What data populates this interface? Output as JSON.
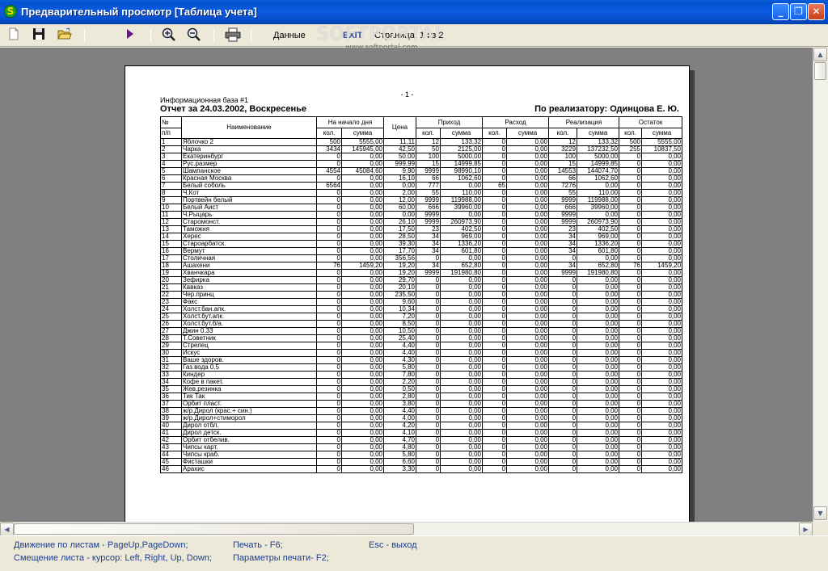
{
  "window": {
    "title": "Предварительный просмотр [Таблица учета]",
    "app_icon": "S",
    "controls": {
      "minimize": "_",
      "maximize": "❐",
      "close": "✕"
    }
  },
  "toolbar": {
    "data_label": "Данные",
    "exit_label": "EXIT",
    "page_label": "Страница: 1 из 2",
    "icons": [
      "new-document-icon",
      "save-icon",
      "open-folder-icon",
      "play-icon",
      "zoom-in-icon",
      "zoom-out-icon",
      "print-icon"
    ]
  },
  "watermark": {
    "text": "SOFTPORTAL",
    "url_text": "www.softportal.com"
  },
  "report": {
    "page_number": "- 1 -",
    "infobase": "Информационная база #1",
    "title": "Отчет за 24.03.2002, Воскресенье",
    "seller": "По реализатору: Одинцова Е. Ю.",
    "headers": {
      "num_top": "№",
      "num_bottom": "п/п",
      "name": "Наименование",
      "start": "На начало дня",
      "price": "Цена",
      "income": "Приход",
      "expense": "Расход",
      "sales": "Реализация",
      "rest": "Остаток",
      "qty": "кол.",
      "sum": "сумма"
    },
    "rows": [
      [
        "1",
        "Яблочко 2",
        "500",
        "5555,00",
        "11,11",
        "12",
        "133,32",
        "0",
        "0,00",
        "12",
        "133,32",
        "500",
        "5555,00"
      ],
      [
        "2",
        "Чарка",
        "3434",
        "145945,00",
        "42,50",
        "50",
        "2125,00",
        "0",
        "0,00",
        "3229",
        "137232,50",
        "255",
        "10837,50"
      ],
      [
        "3",
        "Екатеринбург",
        "0",
        "0,00",
        "50,00",
        "100",
        "5000,00",
        "0",
        "0,00",
        "100",
        "5000,00",
        "0",
        "0,00"
      ],
      [
        "4",
        "Рус.размер",
        "0",
        "0,00",
        "999,99",
        "15",
        "14999,85",
        "0",
        "0,00",
        "15",
        "14999,85",
        "0",
        "0,00"
      ],
      [
        "5",
        "Шампанское",
        "4554",
        "45084,60",
        "9,90",
        "9999",
        "98990,10",
        "0",
        "0,00",
        "14553",
        "144074,70",
        "0",
        "0,00"
      ],
      [
        "6",
        "Красная Москва",
        "0",
        "0,00",
        "16,10",
        "66",
        "1062,60",
        "0",
        "0,00",
        "66",
        "1062,60",
        "0",
        "0,00"
      ],
      [
        "7",
        "Белый соболь",
        "6564",
        "0,00",
        "0,00",
        "777",
        "0,00",
        "65",
        "0,00",
        "7276",
        "0,00",
        "0",
        "0,00"
      ],
      [
        "8",
        "Ч.Кот",
        "0",
        "0,00",
        "2,00",
        "55",
        "110,00",
        "0",
        "0,00",
        "55",
        "110,00",
        "0",
        "0,00"
      ],
      [
        "9",
        "Портвейн белый",
        "0",
        "0,00",
        "12,00",
        "9999",
        "119988,00",
        "0",
        "0,00",
        "9999",
        "119988,00",
        "0",
        "0,00"
      ],
      [
        "10",
        "Белый Аист",
        "0",
        "0,00",
        "60,00",
        "666",
        "39960,00",
        "0",
        "0,00",
        "666",
        "39960,00",
        "0",
        "0,00"
      ],
      [
        "11",
        "Ч.Рыцарь",
        "0",
        "0,00",
        "0,00",
        "9999",
        "0,00",
        "0",
        "0,00",
        "9999",
        "0,00",
        "0",
        "0,00"
      ],
      [
        "12",
        "Старомонст.",
        "0",
        "0,00",
        "26,10",
        "9999",
        "260973,90",
        "0",
        "0,00",
        "9999",
        "260973,90",
        "0",
        "0,00"
      ],
      [
        "13",
        "Таможня",
        "0",
        "0,00",
        "17,50",
        "23",
        "402,50",
        "0",
        "0,00",
        "23",
        "402,50",
        "0",
        "0,00"
      ],
      [
        "14",
        "Херес",
        "0",
        "0,00",
        "28,50",
        "34",
        "969,00",
        "0",
        "0,00",
        "34",
        "969,00",
        "0",
        "0,00"
      ],
      [
        "15",
        "Староарбатск.",
        "0",
        "0,00",
        "39,30",
        "34",
        "1336,20",
        "0",
        "0,00",
        "34",
        "1336,20",
        "0",
        "0,00"
      ],
      [
        "16",
        "Вермут",
        "0",
        "0,00",
        "17,70",
        "34",
        "601,80",
        "0",
        "0,00",
        "34",
        "601,80",
        "0",
        "0,00"
      ],
      [
        "17",
        "Столичная",
        "0",
        "0,00",
        "356,56",
        "0",
        "0,00",
        "0",
        "0,00",
        "0",
        "0,00",
        "0",
        "0,00"
      ],
      [
        "18",
        "Ашахени",
        "76",
        "1459,20",
        "19,20",
        "34",
        "652,80",
        "0",
        "0,00",
        "34",
        "652,80",
        "76",
        "1459,20"
      ],
      [
        "19",
        "Хванчкара",
        "0",
        "0,00",
        "19,20",
        "9999",
        "191980,80",
        "0",
        "0,00",
        "9999",
        "191980,80",
        "0",
        "0,00"
      ],
      [
        "20",
        "Зефирка",
        "0",
        "0,00",
        "29,70",
        "0",
        "0,00",
        "0",
        "0,00",
        "0",
        "0,00",
        "0",
        "0,00"
      ],
      [
        "21",
        "Кавказ",
        "0",
        "0,00",
        "20,10",
        "0",
        "0,00",
        "0",
        "0,00",
        "0",
        "0,00",
        "0",
        "0,00"
      ],
      [
        "22",
        "Чер.принц",
        "0",
        "0,00",
        "235,50",
        "0",
        "0,00",
        "0",
        "0,00",
        "0",
        "0,00",
        "0",
        "0,00"
      ],
      [
        "23",
        "Факс",
        "0",
        "0,00",
        "9,60",
        "0",
        "0,00",
        "0",
        "0,00",
        "0",
        "0,00",
        "0",
        "0,00"
      ],
      [
        "24",
        "Холст.бан.апк.",
        "0",
        "0,00",
        "10,34",
        "0",
        "0,00",
        "0",
        "0,00",
        "0",
        "0,00",
        "0",
        "0,00"
      ],
      [
        "25",
        "Холст.бут.апк.",
        "0",
        "0,00",
        "7,20",
        "0",
        "0,00",
        "0",
        "0,00",
        "0",
        "0,00",
        "0",
        "0,00"
      ],
      [
        "26",
        "Холст.бут.б/а.",
        "0",
        "0,00",
        "8,50",
        "0",
        "0,00",
        "0",
        "0,00",
        "0",
        "0,00",
        "0",
        "0,00"
      ],
      [
        "27",
        "Джин 0.33",
        "0",
        "0,00",
        "10,50",
        "0",
        "0,00",
        "0",
        "0,00",
        "0",
        "0,00",
        "0",
        "0,00"
      ],
      [
        "28",
        "Т.Советник",
        "0",
        "0,00",
        "25,40",
        "0",
        "0,00",
        "0",
        "0,00",
        "0",
        "0,00",
        "0",
        "0,00"
      ],
      [
        "29",
        "Стрелец",
        "0",
        "0,00",
        "4,40",
        "0",
        "0,00",
        "0",
        "0,00",
        "0",
        "0,00",
        "0",
        "0,00"
      ],
      [
        "30",
        "Искус",
        "0",
        "0,00",
        "4,40",
        "0",
        "0,00",
        "0",
        "0,00",
        "0",
        "0,00",
        "0",
        "0,00"
      ],
      [
        "31",
        "Ваше здоров.",
        "0",
        "0,00",
        "4,30",
        "0",
        "0,00",
        "0",
        "0,00",
        "0",
        "0,00",
        "0",
        "0,00"
      ],
      [
        "32",
        "Газ.вода 0.5",
        "0",
        "0,00",
        "5,80",
        "0",
        "0,00",
        "0",
        "0,00",
        "0",
        "0,00",
        "0",
        "0,00"
      ],
      [
        "33",
        "Киндер",
        "0",
        "0,00",
        "7,80",
        "0",
        "0,00",
        "0",
        "0,00",
        "0",
        "0,00",
        "0",
        "0,00"
      ],
      [
        "34",
        "Кофе в пакет.",
        "0",
        "0,00",
        "2,20",
        "0",
        "0,00",
        "0",
        "0,00",
        "0",
        "0,00",
        "0",
        "0,00"
      ],
      [
        "35",
        "Жев.резинка",
        "0",
        "0,00",
        "0,50",
        "0",
        "0,00",
        "0",
        "0,00",
        "0",
        "0,00",
        "0",
        "0,00"
      ],
      [
        "36",
        "Тик Так",
        "0",
        "0,00",
        "2,80",
        "0",
        "0,00",
        "0",
        "0,00",
        "0",
        "0,00",
        "0",
        "0,00"
      ],
      [
        "37",
        "Орбит пласт.",
        "0",
        "0,00",
        "3,80",
        "0",
        "0,00",
        "0",
        "0,00",
        "0",
        "0,00",
        "0",
        "0,00"
      ],
      [
        "38",
        "ж/р.Дирол (крас.+ син.)",
        "0",
        "0,00",
        "4,40",
        "0",
        "0,00",
        "0",
        "0,00",
        "0",
        "0,00",
        "0",
        "0,00"
      ],
      [
        "39",
        "ж/р.Дирол+стиморол",
        "0",
        "0,00",
        "4,00",
        "0",
        "0,00",
        "0",
        "0,00",
        "0",
        "0,00",
        "0",
        "0,00"
      ],
      [
        "40",
        "Дирол отбл.",
        "0",
        "0,00",
        "4,20",
        "0",
        "0,00",
        "0",
        "0,00",
        "0",
        "0,00",
        "0",
        "0,00"
      ],
      [
        "41",
        "Дирол детск.",
        "0",
        "0,00",
        "4,10",
        "0",
        "0,00",
        "0",
        "0,00",
        "0",
        "0,00",
        "0",
        "0,00"
      ],
      [
        "42",
        "Орбит отбелив.",
        "0",
        "0,00",
        "4,70",
        "0",
        "0,00",
        "0",
        "0,00",
        "0",
        "0,00",
        "0",
        "0,00"
      ],
      [
        "43",
        "Чипсы карт.",
        "0",
        "0,00",
        "4,80",
        "0",
        "0,00",
        "0",
        "0,00",
        "0",
        "0,00",
        "0",
        "0,00"
      ],
      [
        "44",
        "Чипсы краб.",
        "0",
        "0,00",
        "5,80",
        "0",
        "0,00",
        "0",
        "0,00",
        "0",
        "0,00",
        "0",
        "0,00"
      ],
      [
        "45",
        "Фисташки",
        "0",
        "0,00",
        "6,60",
        "0",
        "0,00",
        "0",
        "0,00",
        "0",
        "0,00",
        "0",
        "0,00"
      ],
      [
        "46",
        "Арахис",
        "0",
        "0,00",
        "3,30",
        "0",
        "0,00",
        "0",
        "0,00",
        "0",
        "0,00",
        "0",
        "0,00"
      ]
    ]
  },
  "help": {
    "nav_pages": "Движение по листам - PageUp,PageDown;",
    "nav_shift": "Смещение листа - курсор: Left, Right, Up, Down;",
    "print": "Печать - F6;",
    "print_params": "Параметры печати- F2;",
    "exit": "Esc - выход"
  },
  "colors": {
    "titlebar": "#0a5ae0",
    "window_bg": "#ece9d8",
    "workspace_bg": "#808080",
    "help_text": "#1d3e8e",
    "play_icon": "#6a0f8e"
  }
}
